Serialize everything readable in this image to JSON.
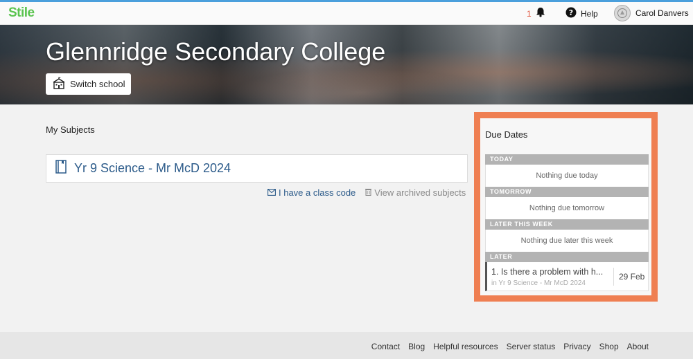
{
  "header": {
    "logo": "Stile",
    "notification_count": "1",
    "help_label": "Help",
    "user_name": "Carol Danvers"
  },
  "banner": {
    "school_name": "Glennridge Secondary College",
    "switch_school_label": "Switch school"
  },
  "subjects": {
    "heading": "My Subjects",
    "items": [
      {
        "name": "Yr 9 Science - Mr McD 2024"
      }
    ],
    "class_code_link": "I have a class code",
    "archived_link": "View archived subjects"
  },
  "due_dates": {
    "heading": "Due Dates",
    "sections": [
      {
        "label": "TODAY",
        "empty_text": "Nothing due today"
      },
      {
        "label": "TOMORROW",
        "empty_text": "Nothing due tomorrow"
      },
      {
        "label": "LATER THIS WEEK",
        "empty_text": "Nothing due later this week"
      }
    ],
    "later": {
      "label": "LATER",
      "items": [
        {
          "title": "1. Is there a problem with h...",
          "subject": "in Yr 9 Science - Mr McD 2024",
          "date": "29 Feb"
        }
      ]
    }
  },
  "footer": {
    "links": [
      "Contact",
      "Blog",
      "Helpful resources",
      "Server status",
      "Privacy",
      "Shop",
      "About"
    ]
  },
  "colors": {
    "brand": "#5ac44f",
    "highlight": "#ef7f52",
    "link": "#2c5b8a",
    "notification": "#e0523a"
  }
}
